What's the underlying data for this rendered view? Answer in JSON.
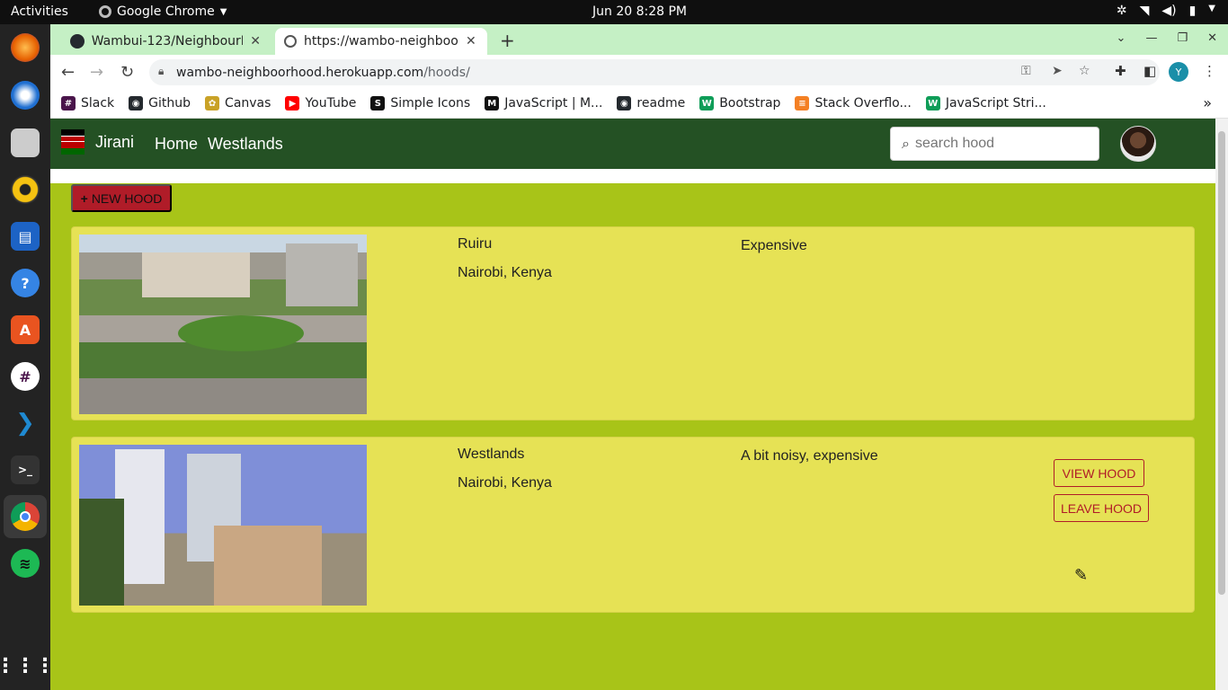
{
  "os": {
    "activities": "Activities",
    "app_name": "Google Chrome",
    "clock": "Jun 20  8:28 PM"
  },
  "tabs": [
    {
      "title": "Wambui-123/NeighbourH",
      "close": "✕"
    },
    {
      "title": "https://wambo-neighboo",
      "close": "✕"
    }
  ],
  "address": {
    "host": "wambo-neighboorhood.herokuapp.com",
    "path": "/hoods/"
  },
  "profile_initial": "Y",
  "bookmarks": [
    {
      "label": "Slack",
      "color": "#4a154b"
    },
    {
      "label": "Github",
      "color": "#24292e"
    },
    {
      "label": "Canvas",
      "color": "#c9a227"
    },
    {
      "label": "YouTube",
      "color": "#ff0000"
    },
    {
      "label": "Simple Icons",
      "color": "#111111"
    },
    {
      "label": "JavaScript | M...",
      "color": "#111111"
    },
    {
      "label": "readme",
      "color": "#24292e"
    },
    {
      "label": "Bootstrap",
      "color": "#0f9d58"
    },
    {
      "label": "Stack Overflo...",
      "color": "#f48024"
    },
    {
      "label": "JavaScript Stri...",
      "color": "#0f9d58"
    }
  ],
  "site": {
    "brand": "Jirani",
    "nav": [
      "Home",
      "Westlands"
    ],
    "search_placeholder": "search hood",
    "new_hood_label": "NEW HOOD",
    "hoods": [
      {
        "name": "Ruiru",
        "location": "Nairobi, Kenya",
        "description": "Expensive"
      },
      {
        "name": "Westlands",
        "location": "Nairobi, Kenya",
        "description": "A bit noisy, expensive",
        "view_label": "VIEW HOOD",
        "leave_label": "LEAVE HOOD"
      }
    ]
  },
  "colors": {
    "navbar": "#245124",
    "page_bg": "#a8c418",
    "card_bg": "#e6e255",
    "accent": "#b01c28"
  }
}
